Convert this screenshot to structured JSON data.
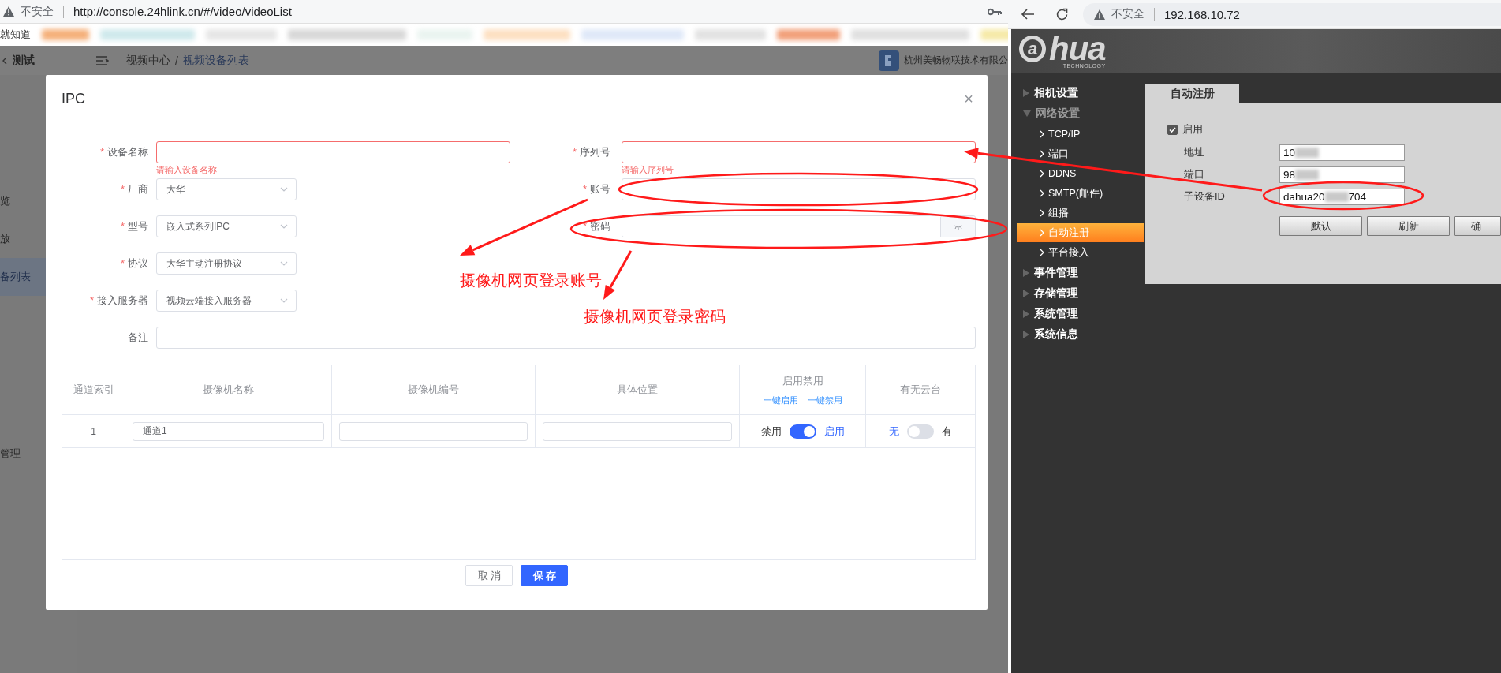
{
  "left_browser": {
    "security": "不安全",
    "url": "http://console.24hlink.cn/#/video/videoList"
  },
  "bookmarks": [
    {
      "label": "就知道"
    }
  ],
  "console": {
    "back_title": "测试",
    "breadcrumb": {
      "items": [
        "视频中心",
        "视频设备列表"
      ],
      "separator": "/"
    },
    "company": "杭州美畅物联技术有限公",
    "sidebar": [
      {
        "label": "览",
        "selected": false
      },
      {
        "label": "放",
        "selected": false
      },
      {
        "label": "备列表",
        "selected": true
      },
      {
        "label": "管理",
        "selected": false
      }
    ]
  },
  "dialog": {
    "title": "IPC",
    "close": "×",
    "required_mark": "*",
    "rows": [
      [
        {
          "label": "设备名称",
          "required": true,
          "kind": "input",
          "error": "请输入设备名称"
        },
        {
          "label": "序列号",
          "required": true,
          "kind": "input",
          "error": "请输入序列号"
        }
      ],
      [
        {
          "label": "厂商",
          "required": true,
          "kind": "select",
          "value": "大华"
        },
        {
          "label": "账号",
          "required": true,
          "kind": "input"
        }
      ],
      [
        {
          "label": "型号",
          "required": true,
          "kind": "select",
          "value": "嵌入式系列IPC"
        },
        {
          "label": "密码",
          "required": true,
          "kind": "password"
        }
      ],
      [
        {
          "label": "协议",
          "required": true,
          "kind": "select",
          "value": "大华主动注册协议"
        }
      ],
      [
        {
          "label": "接入服务器",
          "required": true,
          "kind": "select",
          "value": "视频云端接入服务器"
        }
      ],
      [
        {
          "label": "备注",
          "required": false,
          "kind": "wide_input"
        }
      ]
    ],
    "table": {
      "columns": [
        "通道索引",
        "摄像机名称",
        "摄像机编号",
        "具体位置",
        "启用禁用",
        "有无云台"
      ],
      "bulk_links": [
        "一键启用",
        "一键禁用"
      ],
      "rows": [
        {
          "index": "1",
          "camera_name": "通道1",
          "enabled": {
            "off_label": "禁用",
            "on_label": "启用",
            "on": true
          },
          "ptz": {
            "off_label": "无",
            "on_label": "有",
            "on": false
          }
        }
      ]
    },
    "buttons": [
      {
        "label": "取消",
        "kind": "secondary"
      },
      {
        "label": "保存",
        "kind": "primary"
      }
    ]
  },
  "right_browser": {
    "security": "不安全",
    "url": "192.168.10.72"
  },
  "dahua": {
    "logo": {
      "mark": "a",
      "text": "hua",
      "subtitle": "TECHNOLOGY"
    },
    "menu": [
      {
        "label": "相机设置",
        "expanded": false
      },
      {
        "label": "网络设置",
        "expanded": true,
        "children": [
          {
            "label": "TCP/IP",
            "selected": false
          },
          {
            "label": "端口",
            "selected": false
          },
          {
            "label": "DDNS",
            "selected": false
          },
          {
            "label": "SMTP(邮件)",
            "selected": false
          },
          {
            "label": "组播",
            "selected": false
          },
          {
            "label": "自动注册",
            "selected": true
          },
          {
            "label": "平台接入",
            "selected": false
          }
        ]
      },
      {
        "label": "事件管理",
        "expanded": false
      },
      {
        "label": "存储管理",
        "expanded": false
      },
      {
        "label": "系统管理",
        "expanded": false
      },
      {
        "label": "系统信息",
        "expanded": false
      }
    ],
    "tab": "自动注册",
    "enable": {
      "label": "启用",
      "checked": true
    },
    "fields": [
      {
        "label": "地址",
        "value": "10"
      },
      {
        "label": "端口",
        "value": "98"
      },
      {
        "label": "子设备ID",
        "value": "dahua20",
        "value_end": "704"
      }
    ],
    "buttons": [
      "默认",
      "刷新",
      "确"
    ]
  },
  "annotations": {
    "labels": [
      "摄像机网页登录账号",
      "摄像机网页登录密码"
    ]
  }
}
